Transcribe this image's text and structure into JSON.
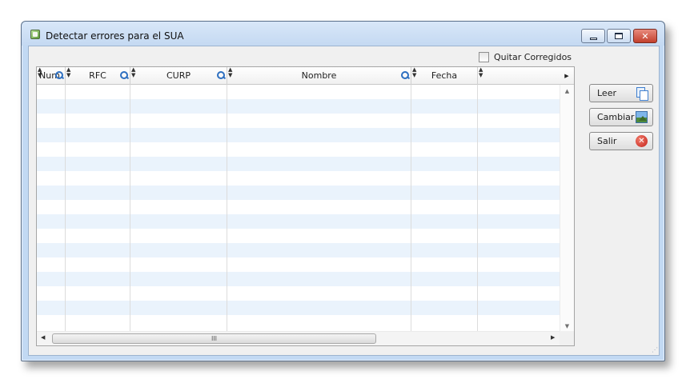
{
  "window": {
    "title": "Detectar errores para el SUA",
    "controls": {
      "minimize": "",
      "maximize": "",
      "close": "✕"
    }
  },
  "filter": {
    "quitar_corregidos_label": "Quitar Corregidos",
    "quitar_corregidos_checked": false
  },
  "grid": {
    "columns": [
      {
        "label": "Num",
        "filter": true
      },
      {
        "label": "RFC",
        "filter": true
      },
      {
        "label": "CURP",
        "filter": true
      },
      {
        "label": "Nombre",
        "filter": true
      },
      {
        "label": "Fecha",
        "filter": false
      },
      {
        "label": "",
        "filter": false
      }
    ],
    "rows": [],
    "hscroll_thumb": "III"
  },
  "buttons": {
    "leer": "Leer",
    "cambiar": "Cambiar",
    "salir": "Salir"
  },
  "icons": {
    "app": "app-window-icon",
    "leer": "copy-icon",
    "cambiar": "image-icon",
    "salir": "close-circle-icon"
  },
  "colors": {
    "row_alt": "#eaf3fc",
    "frame": "#c2d9f3",
    "close_button": "#c3402d",
    "filter_icon": "#2d6fc0"
  }
}
